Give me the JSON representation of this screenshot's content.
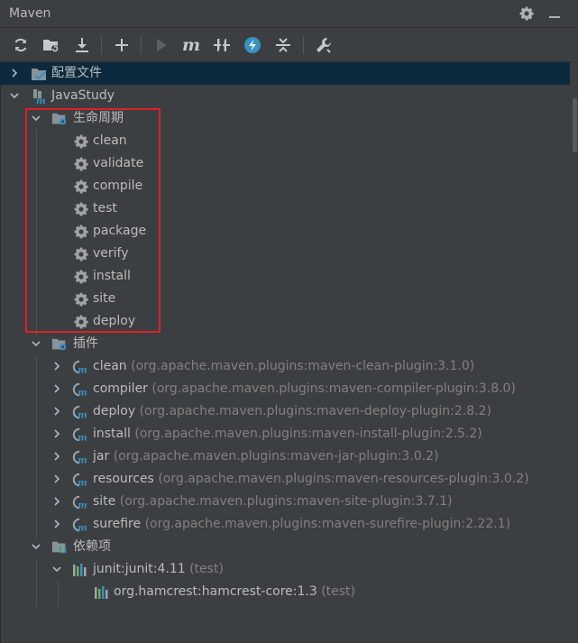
{
  "window": {
    "title": "Maven"
  },
  "toolbar": {
    "buttons": [
      {
        "name": "reload-all-button",
        "icon": "reload-icon",
        "enabled": true
      },
      {
        "name": "generate-sources-button",
        "icon": "folder-sync-icon",
        "enabled": true
      },
      {
        "name": "download-sources-button",
        "icon": "download-icon",
        "enabled": true
      },
      {
        "name": "add-project-button",
        "icon": "plus-icon",
        "enabled": true
      },
      {
        "name": "run-button",
        "icon": "play-icon",
        "enabled": false
      },
      {
        "name": "execute-goal-button",
        "icon": "maven-m-icon",
        "enabled": true
      },
      {
        "name": "toggle-offline-button",
        "icon": "offline-icon",
        "enabled": true
      },
      {
        "name": "skip-tests-button",
        "icon": "skip-tests-icon",
        "enabled": true
      },
      {
        "name": "collapse-all-button",
        "icon": "collapse-icon",
        "enabled": true
      },
      {
        "name": "settings-button",
        "icon": "wrench-icon",
        "enabled": true
      }
    ]
  },
  "tree": {
    "config": {
      "label": "配置文件"
    },
    "project": {
      "label": "JavaStudy"
    },
    "lifecycle": {
      "label": "生命周期",
      "goals": [
        "clean",
        "validate",
        "compile",
        "test",
        "package",
        "verify",
        "install",
        "site",
        "deploy"
      ]
    },
    "plugins": {
      "label": "插件",
      "items": [
        {
          "name": "clean",
          "detail": "(org.apache.maven.plugins:maven-clean-plugin:3.1.0)"
        },
        {
          "name": "compiler",
          "detail": "(org.apache.maven.plugins:maven-compiler-plugin:3.8.0)"
        },
        {
          "name": "deploy",
          "detail": "(org.apache.maven.plugins:maven-deploy-plugin:2.8.2)"
        },
        {
          "name": "install",
          "detail": "(org.apache.maven.plugins:maven-install-plugin:2.5.2)"
        },
        {
          "name": "jar",
          "detail": "(org.apache.maven.plugins:maven-jar-plugin:3.0.2)"
        },
        {
          "name": "resources",
          "detail": "(org.apache.maven.plugins:maven-resources-plugin:3.0.2)"
        },
        {
          "name": "site",
          "detail": "(org.apache.maven.plugins:maven-site-plugin:3.7.1)"
        },
        {
          "name": "surefire",
          "detail": "(org.apache.maven.plugins:maven-surefire-plugin:2.22.1)"
        }
      ]
    },
    "dependencies": {
      "label": "依赖项",
      "items": [
        {
          "name": "junit:junit:4.11",
          "scope": "(test)"
        },
        {
          "name": "org.hamcrest:hamcrest-core:1.3",
          "scope": "(test)"
        }
      ]
    }
  },
  "colors": {
    "background": "#3c3f41",
    "selection": "#0d293e",
    "highlight_box": "#e01f27",
    "maven_blue": "#3592c4",
    "folder": "#87939a"
  }
}
